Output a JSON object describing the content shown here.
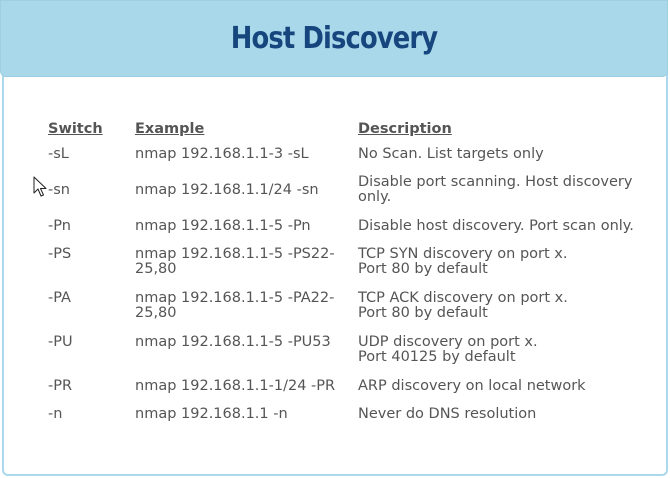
{
  "header": {
    "title": "Host Discovery"
  },
  "table": {
    "headers": {
      "switch": "Switch",
      "example": "Example",
      "description": "Description"
    },
    "rows": [
      {
        "switch": "-sL",
        "example": [
          "nmap 192.168.1.1-3 -sL"
        ],
        "description": [
          "No Scan. List targets only"
        ]
      },
      {
        "switch": "-sn",
        "example": [
          "nmap 192.168.1.1/24 -sn"
        ],
        "description": [
          "Disable port scanning. Host discovery",
          "only."
        ]
      },
      {
        "switch": "-Pn",
        "example": [
          "nmap 192.168.1.1-5 -Pn"
        ],
        "description": [
          "Disable host discovery. Port scan only."
        ]
      },
      {
        "switch": "-PS",
        "example": [
          "nmap 192.168.1.1-5 -PS22-",
          "25,80"
        ],
        "description": [
          "TCP SYN discovery on port x.",
          "Port 80 by default"
        ]
      },
      {
        "switch": "-PA",
        "example": [
          "nmap 192.168.1.1-5 -PA22-",
          "25,80"
        ],
        "description": [
          "TCP ACK discovery on port x.",
          "Port 80 by default"
        ]
      },
      {
        "switch": "-PU",
        "example": [
          "nmap 192.168.1.1-5 -PU53"
        ],
        "description": [
          "UDP discovery on port x.",
          "Port 40125 by default"
        ]
      },
      {
        "switch": "-PR",
        "example": [
          "nmap 192.168.1.1-1/24 -PR"
        ],
        "description": [
          "ARP discovery on local network"
        ]
      },
      {
        "switch": "-n",
        "example": [
          "nmap 192.168.1.1 -n"
        ],
        "description": [
          "Never do DNS resolution"
        ]
      }
    ]
  },
  "colors": {
    "header_bg": "#a8d8e9",
    "title": "#16467d",
    "text": "#555555",
    "border": "#a9d9ea"
  },
  "icons": {
    "cursor": "mouse-pointer-icon"
  }
}
